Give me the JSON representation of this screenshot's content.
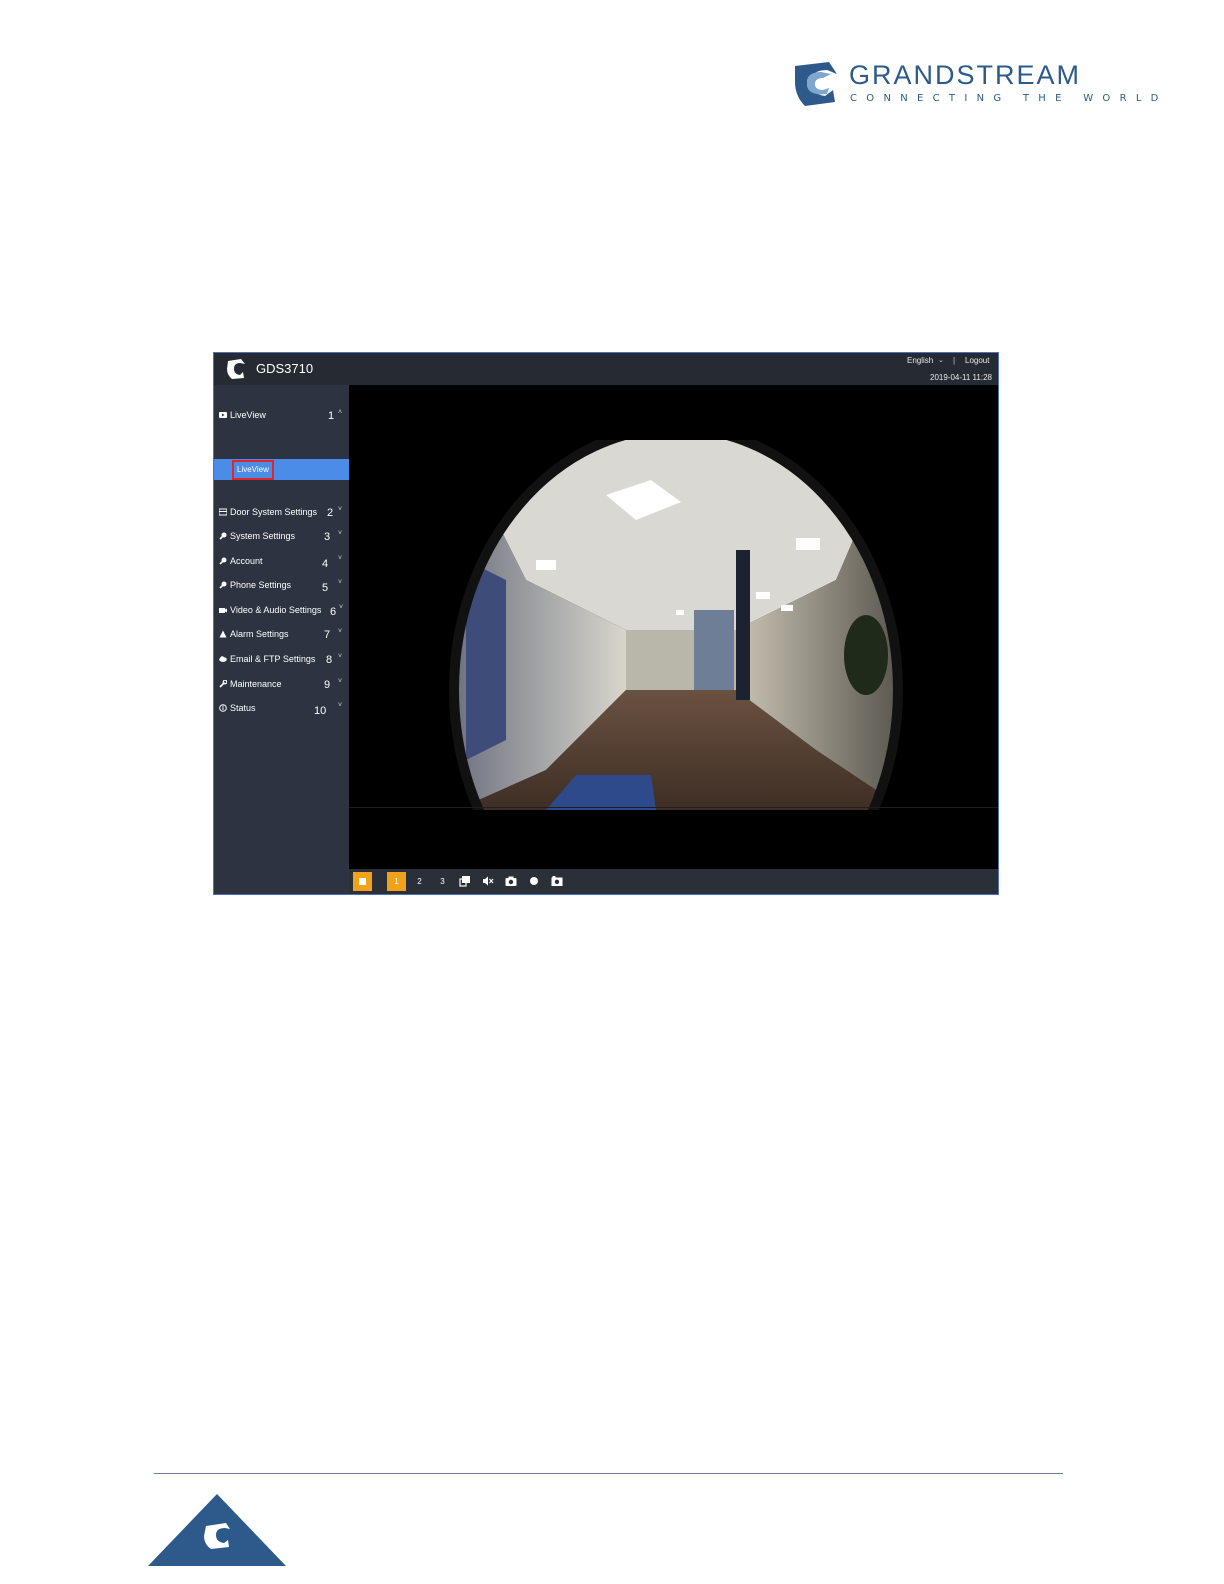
{
  "document": {
    "brand": {
      "name": "GRANDSTREAM",
      "tagline": "CONNECTING THE WORLD",
      "color": "#2d5a8a",
      "icon": "grandstream-logo-icon"
    },
    "footer": {
      "icon": "grandstream-footer-logo-icon",
      "color": "#2d5a8a"
    }
  },
  "app": {
    "header": {
      "model": "GDS3710",
      "language": "English",
      "separator": "|",
      "logout": "Logout",
      "datetime": "2019-04-11 11:28"
    },
    "sidebar": {
      "items": [
        {
          "label": "LiveView",
          "callout": "1",
          "icon": "video-icon",
          "chevron": "˄"
        },
        {
          "label": "Door System Settings",
          "callout": "2",
          "icon": "door-icon",
          "chevron": "˅"
        },
        {
          "label": "System Settings",
          "callout": "3",
          "icon": "wrench-icon",
          "chevron": "˅"
        },
        {
          "label": "Account",
          "callout": "4",
          "icon": "wrench-icon",
          "chevron": "˅"
        },
        {
          "label": "Phone Settings",
          "callout": "5",
          "icon": "wrench-icon",
          "chevron": "˅"
        },
        {
          "label": "Video & Audio Settings",
          "callout": "6",
          "icon": "camera-icon",
          "chevron": "˅"
        },
        {
          "label": "Alarm Settings",
          "callout": "7",
          "icon": "alarm-icon",
          "chevron": "˅"
        },
        {
          "label": "Email & FTP Settings",
          "callout": "8",
          "icon": "cloud-icon",
          "chevron": "˅"
        },
        {
          "label": "Maintenance",
          "callout": "9",
          "icon": "tool-icon",
          "chevron": "˅"
        },
        {
          "label": "Status",
          "callout": "10",
          "icon": "info-icon",
          "chevron": "˅"
        }
      ],
      "active_sub_item": "LiveView",
      "active_color": "#4a8ce8",
      "highlight_border": "#e0262b"
    },
    "toolbar": {
      "streams": [
        "1",
        "2",
        "3"
      ],
      "active_stream": "1",
      "accent": "#f2a11a",
      "icons": [
        "stop-icon",
        "fullscreen-icon",
        "mute-icon",
        "snapshot-icon",
        "record-icon",
        "capture-icon"
      ]
    }
  }
}
